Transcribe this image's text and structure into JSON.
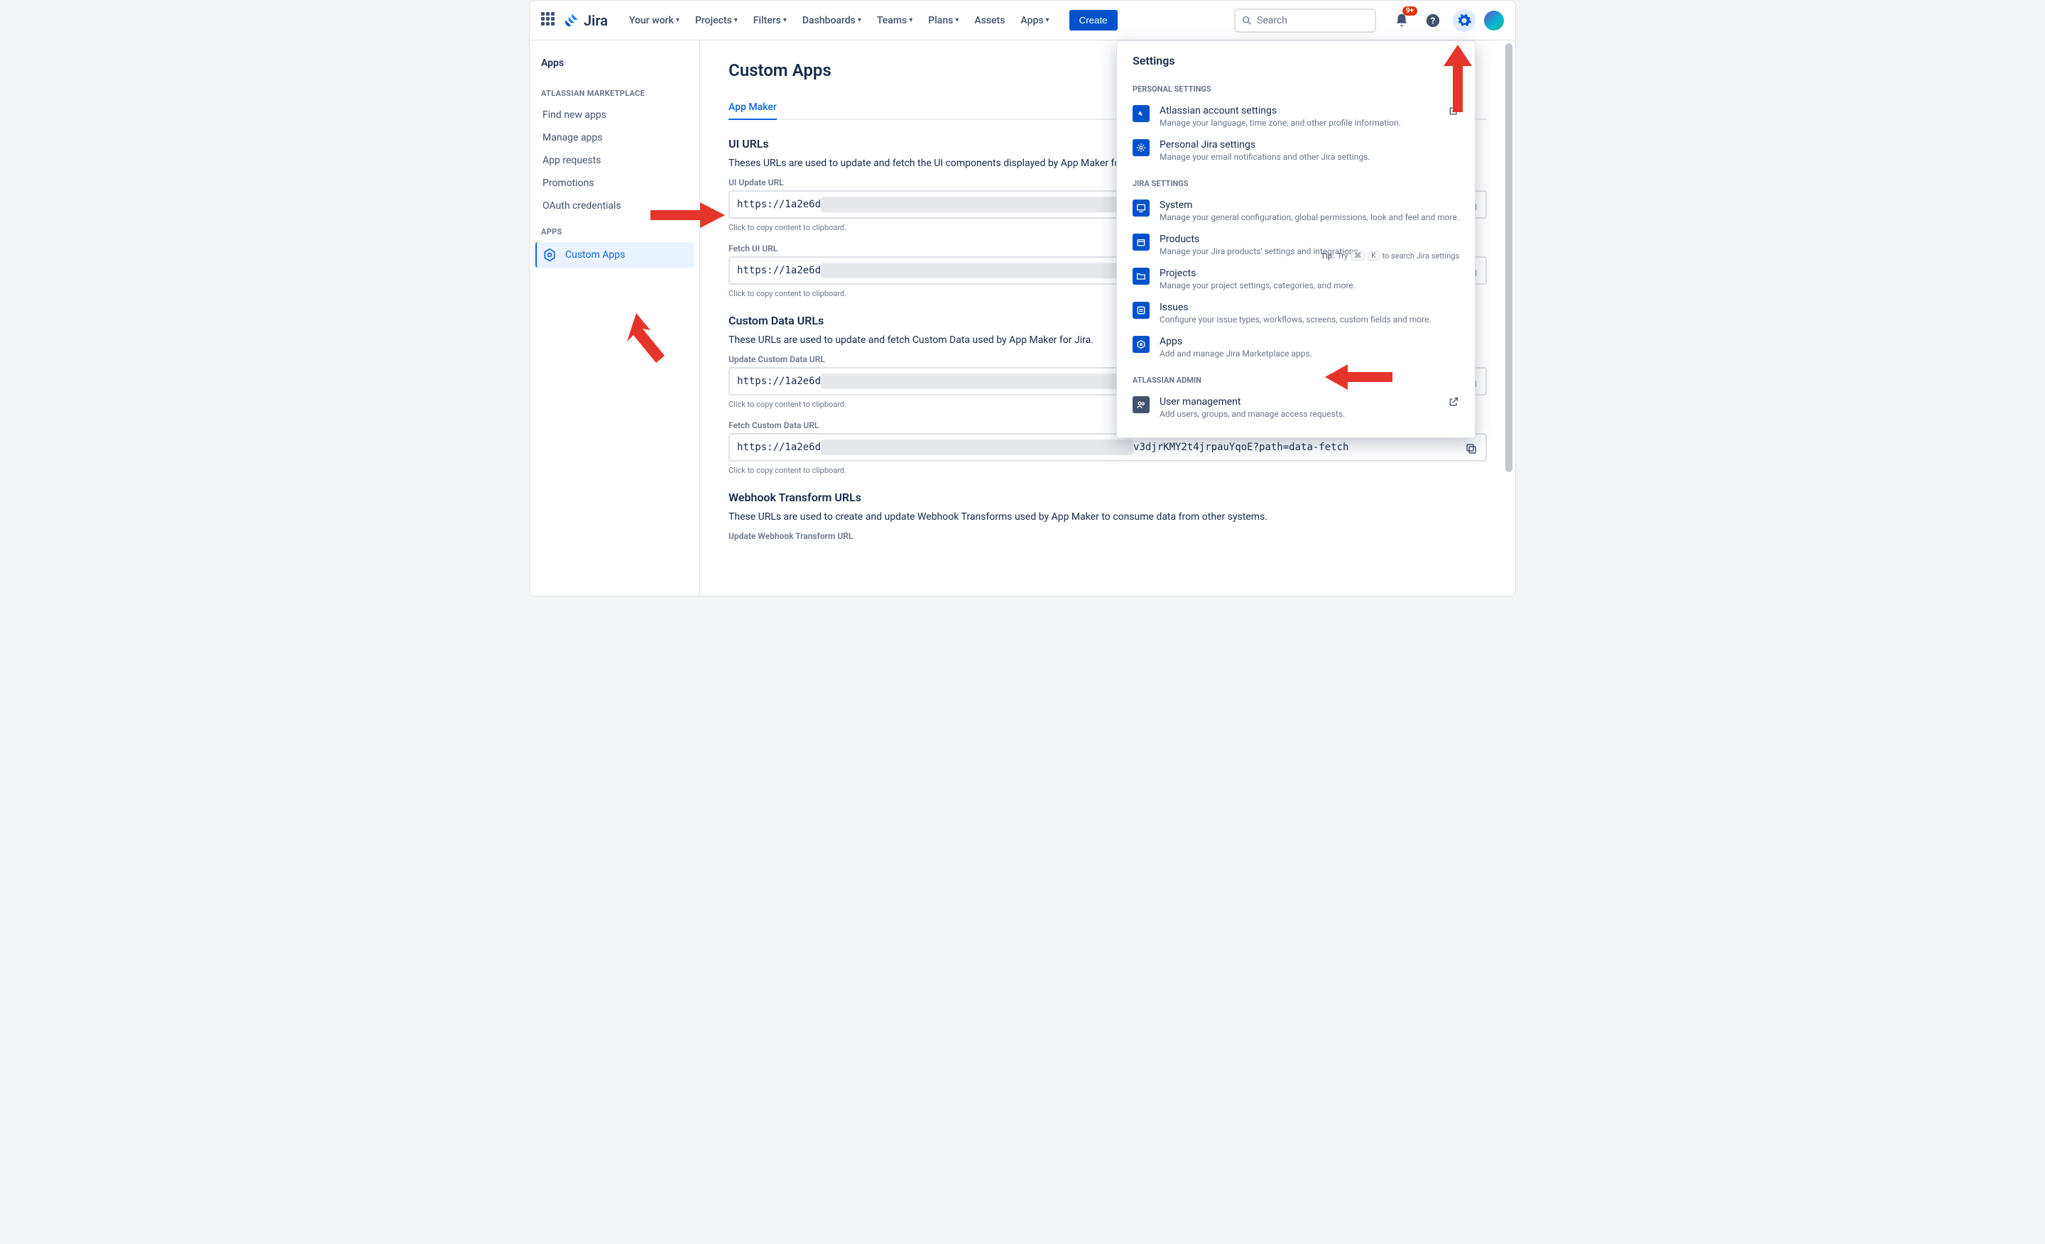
{
  "topbar": {
    "product": "Jira",
    "nav": [
      "Your work",
      "Projects",
      "Filters",
      "Dashboards",
      "Teams",
      "Plans",
      "Assets",
      "Apps"
    ],
    "nav_has_chevron": [
      true,
      true,
      true,
      true,
      true,
      true,
      false,
      true
    ],
    "create": "Create",
    "search_placeholder": "Search",
    "notification_badge": "9+"
  },
  "sidebar": {
    "title": "Apps",
    "section1_label": "ATLASSIAN MARKETPLACE",
    "items1": [
      "Find new apps",
      "Manage apps",
      "App requests",
      "Promotions",
      "OAuth credentials"
    ],
    "section2_label": "APPS",
    "active_item": "Custom Apps"
  },
  "main": {
    "page_title": "Custom Apps",
    "tab": "App Maker",
    "s1_title": "UI URLs",
    "s1_desc": "Theses URLs are used to update and fetch the UI components displayed by App Maker for Jira.",
    "f1_label": "UI Update URL",
    "f1_value_visible": "https://1a2e6d",
    "f1_hint": "Click to copy content to clipboard.",
    "f2_label": "Fetch UI URL",
    "f2_value_visible": "https://1a2e6d",
    "f2_hint": "Click to copy content to clipboard.",
    "s2_title": "Custom Data URLs",
    "s2_desc": "These URLs are used to update and fetch Custom Data used by App Maker for Jira.",
    "f3_label": "Update Custom Data URL",
    "f3_value_visible": "https://1a2e6d",
    "f3_hint": "Click to copy content to clipboard.",
    "f4_label": "Fetch Custom Data URL",
    "f4_value_prefix": "https://1a2e6d",
    "f4_value_suffix": "v3djrKMY2t4jrpauYqoE?path=data-fetch",
    "f4_hint": "Click to copy content to clipboard.",
    "s3_title": "Webhook Transform URLs",
    "s3_desc": "These URLs are used to create and update Webhook Transforms used by App Maker to consume data from other systems.",
    "f5_label": "Update Webhook Transform URL"
  },
  "settings": {
    "title": "Settings",
    "sec_personal": "PERSONAL SETTINGS",
    "rows_personal": [
      {
        "t": "Atlassian account settings",
        "s": "Manage your language, time zone, and other profile information.",
        "ext": true,
        "icon": "atl"
      },
      {
        "t": "Personal Jira settings",
        "s": "Manage your email notifications and other Jira settings.",
        "ext": false,
        "icon": "gear"
      }
    ],
    "sec_jira": "JIRA SETTINGS",
    "tip_label": "Tip:",
    "tip_try": "Try",
    "tip_k1": "⌘",
    "tip_k2": "K",
    "tip_rest": "to search Jira settings",
    "rows_jira": [
      {
        "t": "System",
        "s": "Manage your general configuration, global permissions, look and feel and more.",
        "icon": "monitor"
      },
      {
        "t": "Products",
        "s": "Manage your Jira products' settings and integrations.",
        "icon": "box"
      },
      {
        "t": "Projects",
        "s": "Manage your project settings, categories, and more.",
        "icon": "folder"
      },
      {
        "t": "Issues",
        "s": "Configure your issue types, workflows, screens, custom fields and more.",
        "icon": "list"
      },
      {
        "t": "Apps",
        "s": "Add and manage Jira Marketplace apps.",
        "icon": "hex"
      }
    ],
    "sec_admin": "ATLASSIAN ADMIN",
    "rows_admin": [
      {
        "t": "User management",
        "s": "Add users, groups, and manage access requests.",
        "ext": true,
        "icon": "users"
      }
    ]
  }
}
